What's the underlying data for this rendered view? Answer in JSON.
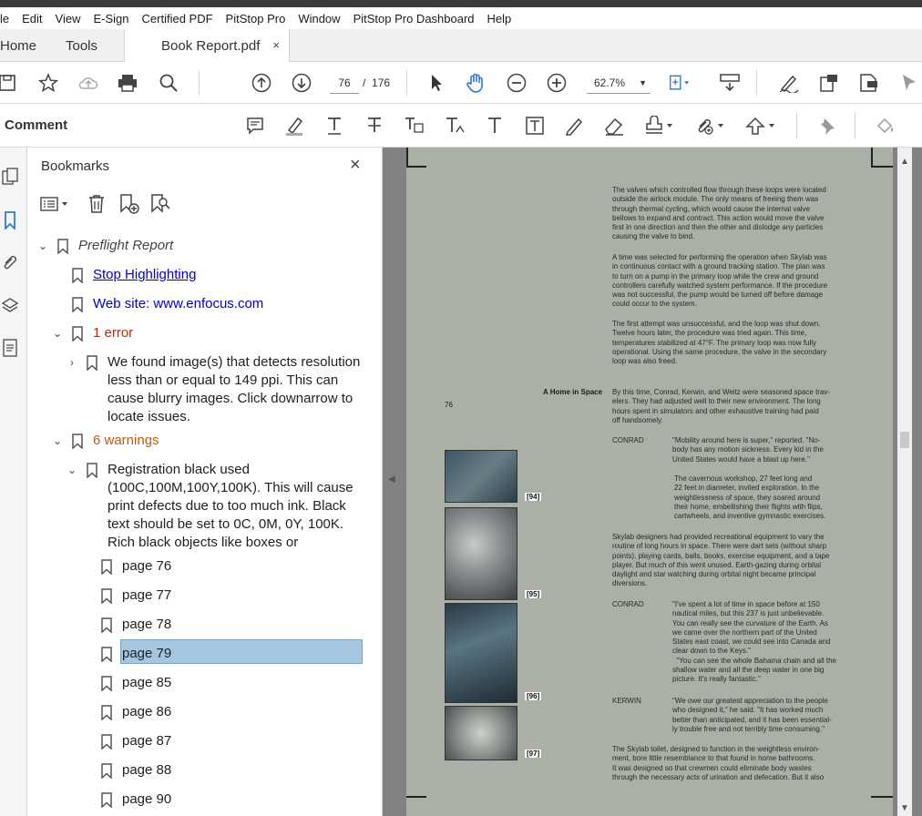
{
  "menu": [
    "le",
    "Edit",
    "View",
    "E-Sign",
    "Certified PDF",
    "PitStop Pro",
    "Window",
    "PitStop Pro Dashboard",
    "Help"
  ],
  "tabs": {
    "home": "Home",
    "tools": "Tools",
    "doc": "Book Report.pdf",
    "close": "×"
  },
  "toolbar": {
    "page_current": "76",
    "page_sep": "/",
    "page_total": "176",
    "zoom": "62.7%"
  },
  "comment": {
    "label": "Comment"
  },
  "panel": {
    "title": "Bookmarks",
    "close": "×",
    "items": [
      {
        "label": "Preflight Report"
      },
      {
        "label": "Stop Highlighting"
      },
      {
        "label": "Web site: www.enfocus.com"
      },
      {
        "label": "1 error"
      },
      {
        "label": "We found image(s) that detects resolution\nless than or equal to 149 ppi. This can\ncause blurry images. Click downarrow to\nlocate issues."
      },
      {
        "label": "6 warnings"
      },
      {
        "label": "Registration black used\n(100C,100M,100Y,100K). This will cause\nprint defects due to too much ink. Black\ntext should be set to 0C, 0M, 0Y, 100K.\nRich black objects like boxes or"
      },
      {
        "label": "page 76"
      },
      {
        "label": "page 77"
      },
      {
        "label": "page 78"
      },
      {
        "label": "page 79"
      },
      {
        "label": "page 85"
      },
      {
        "label": "page 86"
      },
      {
        "label": "page 87"
      },
      {
        "label": "page 88"
      },
      {
        "label": "page 90"
      }
    ]
  },
  "page": {
    "section_head": "A Home in Space",
    "page_number": "76",
    "paragraphs": [
      "The valves which controlled flow through these loops were located\noutside the airlock module. The only means of freeing them was\nthrough thermal cycling, which would cause the internal valve\nbellows to expand and contract. This action would move the valve\nfirst in one direction and then the other and dislodge any particles\ncausing the valve to bind.",
      "A time was selected for performing the operation when Skylab was\nin continuous contact with a ground tracking station. The plan was\nto turn on a pump in the primary loop while the crew and ground\ncontrollers carefully watched system performance. If the procedure\nwas not successful, the pump would be turned off before damage\ncould occur to the system.",
      "The first attempt was unsuccessful, and the loop was shut down.\nTwelve hours later, the procedure was tried again. This time,\ntemperatures stabilized at 47°F. The primary loop was now fully\noperational. Using the same procedure, the valve in the secondary\nloop was also freed.",
      "By this time, Conrad, Kerwin, and Weitz were seasoned space trav-\nelers. They had adjusted well to their new environment. The long\nhours spent in simulators and other exhaustive training had paid\noff handsomely.",
      "Skylab designers had provided recreational equipment to vary the\nroutine of long hours in space. There were dart sets (without sharp\npoints), playing cards, balls, books, exercise equipment, and a tape\nplayer. But much of this went unused. Earth-gazing during orbital\ndaylight and star watching during orbital night became principal\ndiversions.",
      "The Skylab toilet, designed to function in the weightless environ-\nment, bore little resemblance to that found in home bathrooms.\nIt was designed so that crewmen could eliminate body wastes\nthrough the necessary acts of urination and defecation. But it also"
    ],
    "quotes": [
      {
        "speaker": "CONRAD",
        "text": "\"Mobility around here is super,\" reported. \"No-\nbody has any motion sickness. Every kid in the\nUnited States would have a blast up here.\""
      },
      {
        "speaker": "",
        "text": "The cavernous workshop, 27 feet long and\n22 feet in diameter, invited exploration. In the\nweightlessness of space, they soared around\ntheir home, embellishing their flights with flips,\ncartwheels, and inventive gymnastic exercises."
      },
      {
        "speaker": "CONRAD",
        "text": "\"I've spent a lot of time in space before at 150\nnautical miles, but this 237 is just unbelievable.\nYou can really see the curvature of the Earth. As\nwe came over the northern part of the United\nStates east coast, we could see into Canada and\nclear down to the Keys.\"\n  \"You can see the whole Bahama chain and all the\nshallow water and all the deep water in one big\npicture. It's really fantastic.\""
      },
      {
        "speaker": "KERWIN",
        "text": "\"We owe our greatest appreciation to the people\nwho designed it,\" he said. \"It has worked much\nbetter than anticipated, and it has been essential-\nly trouble free and not terribly time consuming.\""
      }
    ],
    "figures": [
      "[94]",
      "[95]",
      "[96]",
      "[97]"
    ]
  }
}
